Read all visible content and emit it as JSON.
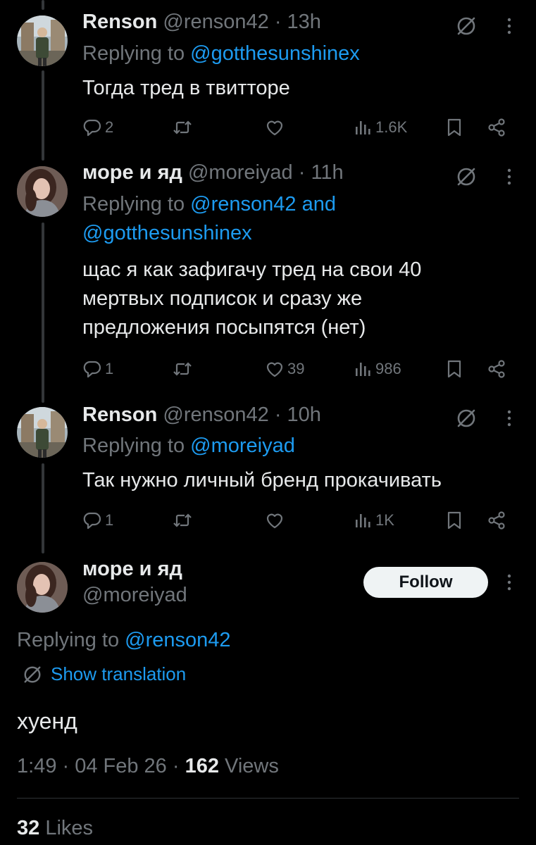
{
  "tweets": [
    {
      "name": "Renson",
      "handle": "@renson42 · 13h",
      "replying_prefix": "Replying to ",
      "replying_users": [
        "@gotthesunshinex"
      ],
      "text_lines": [
        "Тогда тред в твитторе"
      ],
      "replies": "2",
      "retweets": "",
      "likes": "",
      "views": "1.6K"
    },
    {
      "name": "море и яд",
      "handle": "@moreiyad · 11h",
      "replying_prefix": "Replying to ",
      "replying_line1": "@renson42 and",
      "replying_line2": "@gotthesunshinex",
      "text_lines": [
        "щас я как зафигачу тред на свои 40",
        "мертвых подписок и сразу же",
        "предложения посыпятся (нет)"
      ],
      "replies": "1",
      "retweets": "",
      "likes": "39",
      "views": "986"
    },
    {
      "name": "Renson",
      "handle": "@renson42 · 10h",
      "replying_prefix": "Replying to ",
      "replying_users": [
        "@moreiyad"
      ],
      "text_lines": [
        "Так нужно личный бренд прокачивать"
      ],
      "replies": "1",
      "retweets": "",
      "likes": "",
      "views": "1K"
    }
  ],
  "main_tweet": {
    "name": "море и яд",
    "handle": "@moreiyad",
    "follow_label": "Follow",
    "replying_prefix": "Replying to ",
    "replying_user": "@renson42",
    "show_translation": "Show translation",
    "text": "хуенд",
    "time": "1:49 · 04 Feb 26 · ",
    "views_count": "162",
    "views_label": " Views",
    "likes_count": "32",
    "likes_label": " Likes"
  },
  "colors": {
    "background": "#000000",
    "text": "#e7e9ea",
    "secondary": "#71767b",
    "link": "#1d9bf0",
    "follow_bg": "#eff3f4"
  },
  "icons": [
    "translate-icon",
    "more-icon",
    "reply-icon",
    "retweet-icon",
    "like-icon",
    "views-icon",
    "bookmark-icon",
    "share-icon"
  ]
}
